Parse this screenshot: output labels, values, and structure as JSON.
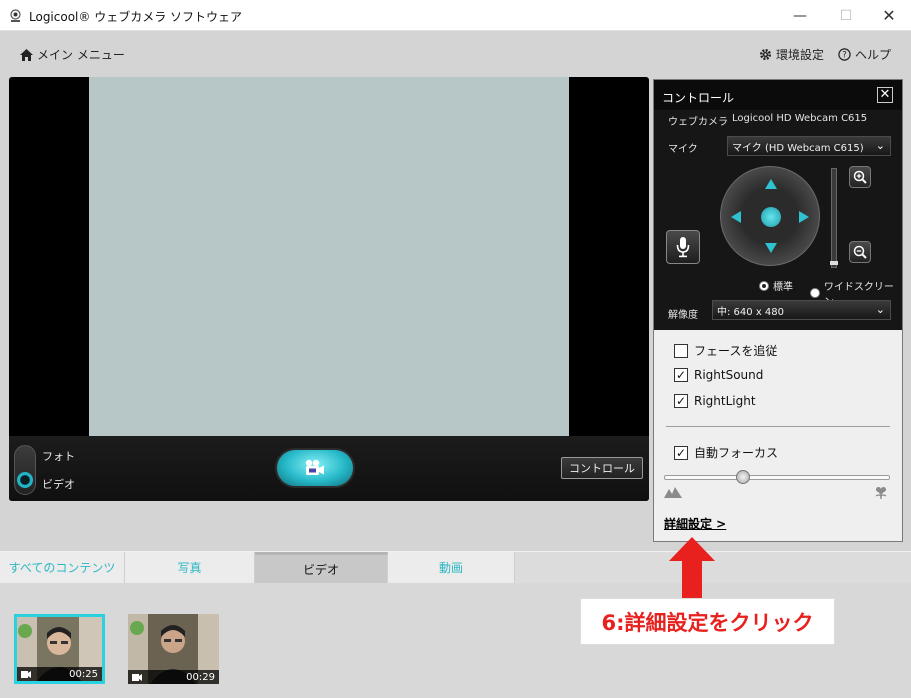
{
  "window": {
    "title": "Logicool® ウェブカメラ ソフトウェア"
  },
  "topbar": {
    "main_menu": "メイン メニュー",
    "settings": "環境設定",
    "help": "ヘルプ"
  },
  "video_bar": {
    "photo_label": "フォト",
    "video_label": "ビデオ",
    "controls_button": "コントロール"
  },
  "control_panel": {
    "title": "コントロール",
    "webcam_label": "ウェブカメラ",
    "webcam_value": "Logicool HD Webcam C615",
    "mic_label": "マイク",
    "mic_value": "マイク (HD Webcam C615)",
    "aspect_standard": "標準",
    "aspect_wide": "ワイドスクリーン",
    "aspect_selected": "standard",
    "resolution_label": "解像度",
    "resolution_value": "中: 640 x 480",
    "checkboxes": [
      {
        "label": "フェースを追従",
        "checked": false
      },
      {
        "label": "RightSound",
        "checked": true
      },
      {
        "label": "RightLight",
        "checked": true
      }
    ],
    "autofocus": {
      "label": "自動フォーカス",
      "checked": true
    },
    "focus_level": 0.35,
    "advanced_link": "詳細設定 >"
  },
  "tabs": [
    {
      "label": "すべてのコンテンツ",
      "active": false
    },
    {
      "label": "写真",
      "active": false
    },
    {
      "label": "ビデオ",
      "active": true
    },
    {
      "label": "動画",
      "active": false
    }
  ],
  "thumbnails": [
    {
      "duration": "00:25",
      "selected": true
    },
    {
      "duration": "00:29",
      "selected": false
    }
  ],
  "annotation": {
    "text": "6:詳細設定をクリック",
    "color": "#e8201e"
  },
  "colors": {
    "accent": "#2cb7c4"
  }
}
